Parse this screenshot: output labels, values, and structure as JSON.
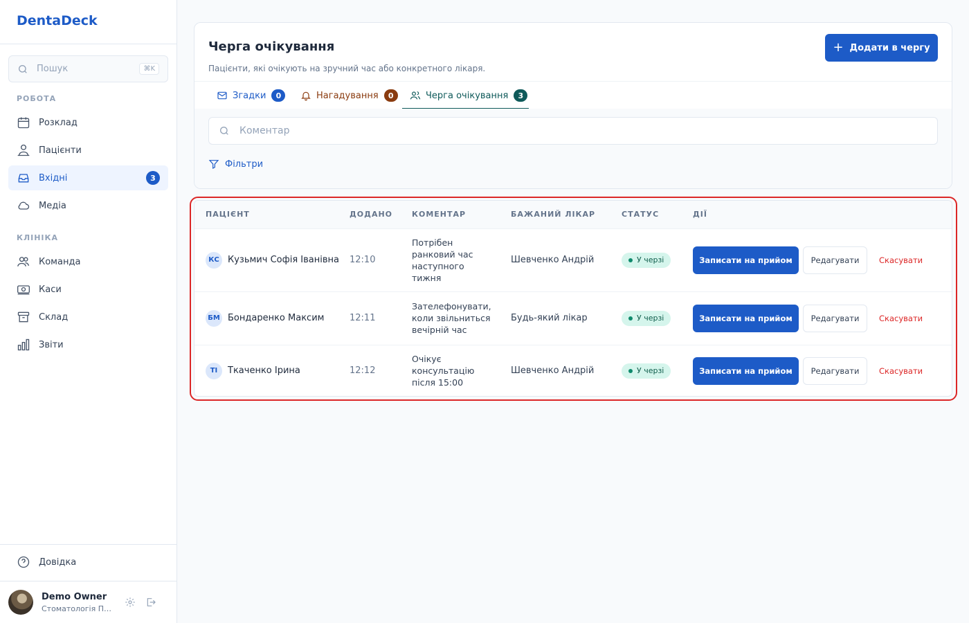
{
  "app": {
    "name": "DentaDeck"
  },
  "sidebar": {
    "search_placeholder": "Пошук",
    "search_shortcut": "⌘K",
    "section_work": "РОБОТА",
    "section_clinic": "КЛІНІКА",
    "items": [
      {
        "label": "Розклад",
        "icon": "calendar-icon"
      },
      {
        "label": "Пацієнти",
        "icon": "patients-icon"
      },
      {
        "label": "Вхідні",
        "icon": "inbox-icon",
        "count": "3",
        "active": true
      },
      {
        "label": "Медіа",
        "icon": "cloud-icon"
      },
      {
        "label": "Команда",
        "icon": "team-icon"
      },
      {
        "label": "Каси",
        "icon": "cash-icon"
      },
      {
        "label": "Склад",
        "icon": "archive-icon"
      },
      {
        "label": "Звіти",
        "icon": "chart-icon"
      }
    ],
    "help_label": "Довідка",
    "user": {
      "name": "Demo Owner",
      "clinic": "Стоматологія Посмішка"
    }
  },
  "header": {
    "title": "Черга очікування",
    "subtitle": "Пацієнти, які очікують на зручний час або конкретного лікаря.",
    "add_button": "Додати в чергу"
  },
  "tabs": [
    {
      "label": "Згадки",
      "count": "0",
      "color": "#1d5bc7",
      "badge_color": "#1d5bc7"
    },
    {
      "label": "Нагадування",
      "count": "0",
      "color": "#8a3b0f",
      "badge_color": "#8a3b0f"
    },
    {
      "label": "Черга очікування",
      "count": "3",
      "color": "#0f5a5a",
      "badge_color": "#0f5a5a",
      "active": true
    }
  ],
  "filter": {
    "comment_placeholder": "Коментар",
    "filters_label": "Фільтри"
  },
  "table": {
    "headers": [
      "ПАЦІЄНТ",
      "ДОДАНО",
      "КОМЕНТАР",
      "БАЖАНИЙ ЛІКАР",
      "СТАТУС",
      "ДІЇ"
    ],
    "rows": [
      {
        "initials": "КС",
        "patient": "Кузьмич Софія Іванівна",
        "added": "12:10",
        "comment": "Потрібен ранковий час наступного тижня",
        "doctor": "Шевченко Андрій",
        "status": "У черзі"
      },
      {
        "initials": "БМ",
        "patient": "Бондаренко Максим",
        "added": "12:11",
        "comment": "Зателефонувати, коли звільниться вечірній час",
        "doctor": "Будь-який лікар",
        "status": "У черзі"
      },
      {
        "initials": "ТІ",
        "patient": "Ткаченко Ірина",
        "added": "12:12",
        "comment": "Очікує консультацію після 15:00",
        "doctor": "Шевченко Андрій",
        "status": "У черзі"
      }
    ],
    "actions": {
      "book": "Записати на прийом",
      "edit": "Редагувати",
      "cancel": "Скасувати"
    }
  },
  "colors": {
    "accent": "#1d5bc7",
    "danger": "#dc2626",
    "status_bg": "#d5f5ec",
    "highlight": "#dc2626"
  }
}
